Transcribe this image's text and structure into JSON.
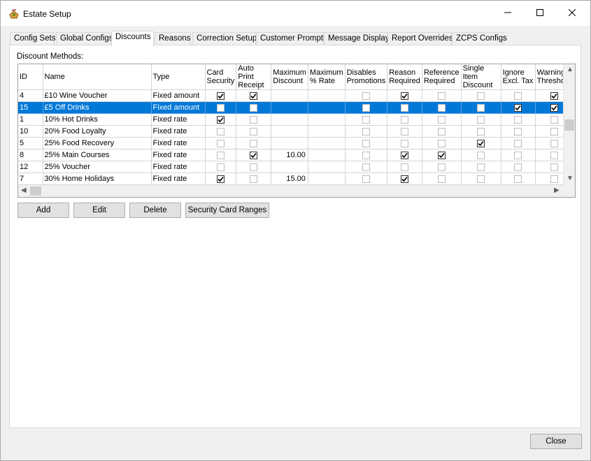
{
  "window": {
    "title": "Estate Setup",
    "close_button": "Close"
  },
  "tabs": [
    {
      "label": "Config Sets"
    },
    {
      "label": "Global Configs"
    },
    {
      "label": "Discounts"
    },
    {
      "label": "Reasons"
    },
    {
      "label": "Correction Setup"
    },
    {
      "label": "Customer Prompts"
    },
    {
      "label": "Message Display"
    },
    {
      "label": "Report Overrides"
    },
    {
      "label": "ZCPS Configs"
    }
  ],
  "active_tab": "Discounts",
  "discount_methods": {
    "label": "Discount Methods:",
    "columns": [
      {
        "label": "ID"
      },
      {
        "label": "Name"
      },
      {
        "label": "Type"
      },
      {
        "label": "Card Security"
      },
      {
        "label": "Auto Print Receipt"
      },
      {
        "label": "Maximum Discount"
      },
      {
        "label": "Maximum % Rate"
      },
      {
        "label": "Disables Promotions"
      },
      {
        "label": "Reason Required"
      },
      {
        "label": "Reference Required"
      },
      {
        "label": "Single Item Discount"
      },
      {
        "label": "Ignore Excl. Tax"
      },
      {
        "label": "Warning Threshold"
      }
    ],
    "rows": [
      {
        "id": "4",
        "name": "£10 Wine Voucher",
        "type": "Fixed amount",
        "max_discount": "",
        "max_rate": "",
        "checks": [
          true,
          true,
          false,
          false,
          true,
          false,
          false,
          false,
          true
        ],
        "selected": false
      },
      {
        "id": "15",
        "name": "£5 Off Drinks",
        "type": "Fixed amount",
        "max_discount": "",
        "max_rate": "",
        "checks": [
          false,
          false,
          false,
          false,
          false,
          false,
          false,
          true,
          true
        ],
        "selected": true
      },
      {
        "id": "1",
        "name": "10% Hot Drinks",
        "type": "Fixed rate",
        "max_discount": "",
        "max_rate": "",
        "checks": [
          true,
          false,
          false,
          false,
          false,
          false,
          false,
          false,
          false
        ],
        "selected": false
      },
      {
        "id": "10",
        "name": "20% Food Loyalty",
        "type": "Fixed rate",
        "max_discount": "",
        "max_rate": "",
        "checks": [
          false,
          false,
          false,
          false,
          false,
          false,
          false,
          false,
          false
        ],
        "selected": false
      },
      {
        "id": "5",
        "name": "25% Food Recovery",
        "type": "Fixed rate",
        "max_discount": "",
        "max_rate": "",
        "checks": [
          false,
          false,
          false,
          false,
          false,
          false,
          true,
          false,
          false
        ],
        "selected": false
      },
      {
        "id": "8",
        "name": "25% Main Courses",
        "type": "Fixed rate",
        "max_discount": "10.00",
        "max_rate": "",
        "checks": [
          false,
          true,
          false,
          false,
          true,
          true,
          false,
          false,
          false
        ],
        "selected": false
      },
      {
        "id": "12",
        "name": "25% Voucher",
        "type": "Fixed rate",
        "max_discount": "",
        "max_rate": "",
        "checks": [
          false,
          false,
          false,
          false,
          false,
          false,
          false,
          false,
          false
        ],
        "selected": false
      },
      {
        "id": "7",
        "name": "30% Home Holidays",
        "type": "Fixed rate",
        "max_discount": "15.00",
        "max_rate": "",
        "checks": [
          true,
          false,
          false,
          false,
          true,
          false,
          false,
          false,
          false
        ],
        "selected": false
      }
    ]
  },
  "buttons": {
    "add": "Add",
    "edit": "Edit",
    "delete": "Delete",
    "security_card_ranges": "Security Card Ranges"
  },
  "colors": {
    "selection": "#0078d7",
    "panel_background": "#ffffff",
    "window_background": "#f0f0f0"
  },
  "icons": {
    "app": "estate-setup-icon",
    "minimize": "minimize-icon",
    "maximize": "maximize-icon",
    "close": "close-icon"
  }
}
